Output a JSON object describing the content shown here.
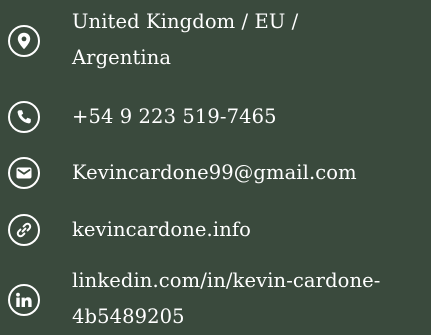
{
  "contact": {
    "location": {
      "icon": "location-pin-icon",
      "line1": "United Kingdom / EU /",
      "line2": "Argentina"
    },
    "phone": {
      "icon": "phone-icon",
      "text": "+54 9 223 519-7465"
    },
    "email": {
      "icon": "envelope-icon",
      "text": "Kevincardone99@gmail.com"
    },
    "website": {
      "icon": "link-icon",
      "text": "kevincardone.info"
    },
    "linkedin": {
      "icon": "linkedin-icon",
      "line1": "linkedin.com/in/kevin-cardone-",
      "line2": "4b5489205"
    }
  },
  "colors": {
    "background": "#3a4a3d",
    "foreground": "#ffffff"
  }
}
